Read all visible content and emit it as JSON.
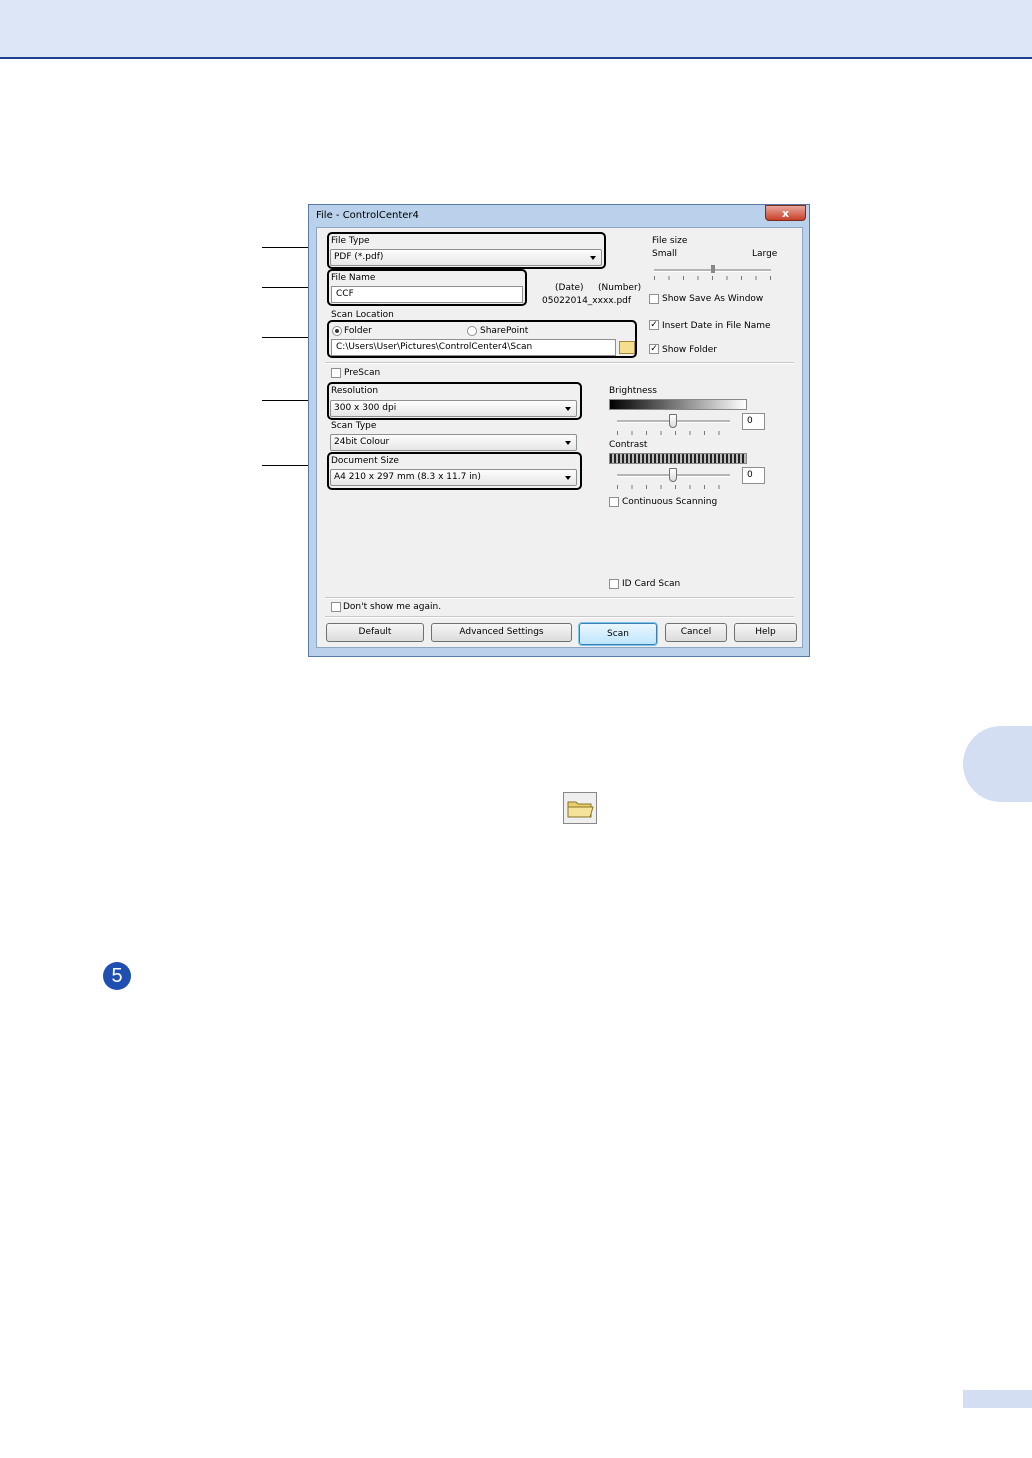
{
  "dialog": {
    "title": "File - ControlCenter4",
    "close_label": "x",
    "file_type": {
      "label": "File Type",
      "value": "PDF (*.pdf)"
    },
    "file_size": {
      "label": "File size",
      "small_label": "Small",
      "large_label": "Large"
    },
    "file_name": {
      "label": "File Name",
      "value": "CCF",
      "date_label": "(Date)",
      "number_label": "(Number)",
      "preview": "05022014_xxxx.pdf"
    },
    "options": {
      "show_save_as": {
        "label": "Show Save As Window",
        "checked": false
      },
      "insert_date": {
        "label": "Insert Date in File Name",
        "checked": true
      },
      "show_folder": {
        "label": "Show Folder",
        "checked": true
      }
    },
    "scan_location": {
      "label": "Scan Location",
      "folder_label": "Folder",
      "sharepoint_label": "SharePoint",
      "selected": "Folder",
      "path": "C:\\Users\\User\\Pictures\\ControlCenter4\\Scan"
    },
    "prescan": {
      "label": "PreScan",
      "checked": false
    },
    "resolution": {
      "label": "Resolution",
      "value": "300 x 300 dpi"
    },
    "scan_type": {
      "label": "Scan Type",
      "value": "24bit Colour"
    },
    "document_size": {
      "label": "Document Size",
      "value": "A4 210 x 297 mm (8.3 x 11.7 in)"
    },
    "brightness": {
      "label": "Brightness",
      "value": "0"
    },
    "contrast": {
      "label": "Contrast",
      "value": "0"
    },
    "continuous_scanning": {
      "label": "Continuous Scanning",
      "checked": false
    },
    "id_card_scan": {
      "label": "ID Card Scan",
      "checked": false
    },
    "dont_show": {
      "label": "Don't show me again.",
      "checked": false
    },
    "buttons": {
      "default": "Default",
      "advanced": "Advanced Settings",
      "scan": "Scan",
      "cancel": "Cancel",
      "help": "Help"
    }
  },
  "step_number": "5",
  "icons": {
    "browse": "folder-icon",
    "step": "step-number-icon"
  },
  "colors": {
    "header_band": "#dde6f7",
    "header_line": "#1f3f8f",
    "tab": "#d4def3",
    "step_circle": "#1f4fb0"
  }
}
